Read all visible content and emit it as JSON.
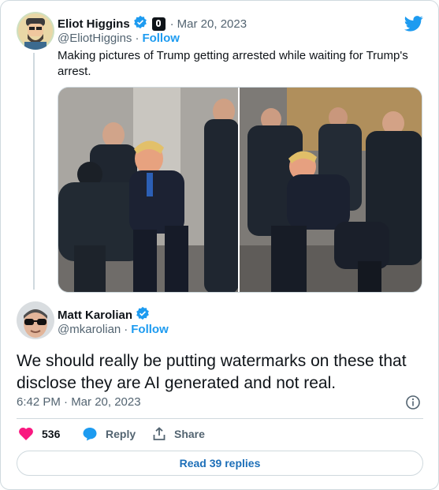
{
  "original_tweet": {
    "author_name": "Eliot Higgins",
    "date": "Mar 20, 2023",
    "separator": "·",
    "handle": "@EliotHiggins",
    "follow_label": "Follow",
    "text": "Making pictures of Trump getting arrested while waiting for Trump's arrest.",
    "media_count": 2
  },
  "reply": {
    "author_name": "Matt Karolian",
    "handle": "@mkarolian",
    "separator": "·",
    "follow_label": "Follow",
    "text": "We should really be putting watermarks on these that disclose they are AI generated and not real.",
    "timestamp": "6:42 PM · Mar 20, 2023"
  },
  "actions": {
    "like_count": "536",
    "reply_label": "Reply",
    "share_label": "Share"
  },
  "read_replies_label": "Read 39 replies",
  "icons": {
    "brand": "twitter-bird-icon",
    "verified": "verified-badge-icon",
    "info": "info-icon",
    "like": "heart-icon",
    "reply": "reply-bubble-icon",
    "share": "share-icon"
  },
  "colors": {
    "accent": "#1d9bf0",
    "like": "#f91880",
    "text_primary": "#0f1419",
    "text_secondary": "#536471",
    "border": "#cfd9de"
  }
}
